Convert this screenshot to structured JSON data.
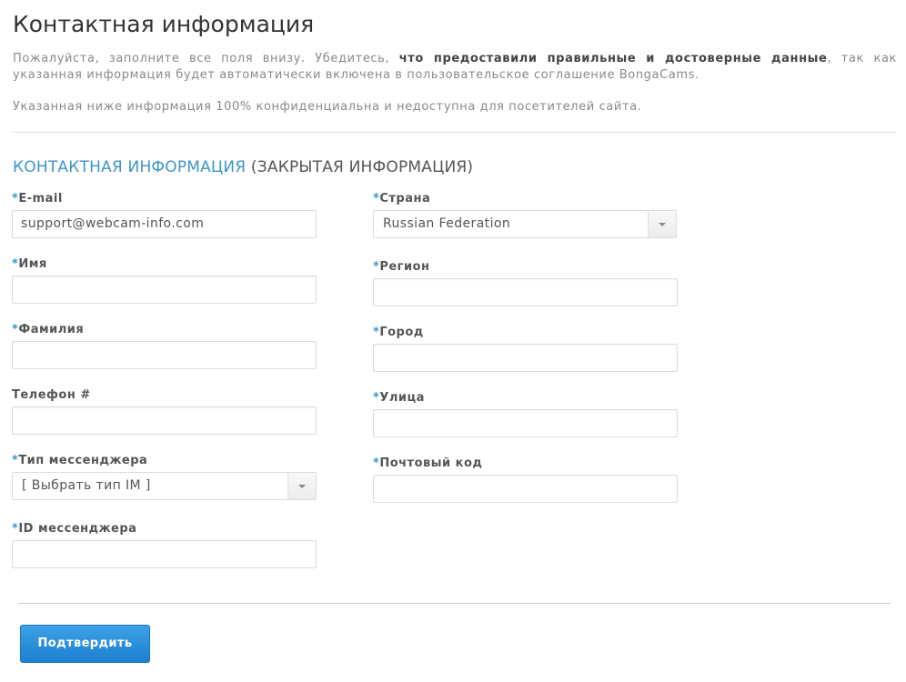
{
  "page": {
    "title": "Контактная информация",
    "intro_before": "Пожалуйста, заполните все поля внизу. Убедитесь, ",
    "intro_bold": "что предоставили правильные и достоверные данные",
    "intro_after": ", так как указанная информация будет автоматически включена в пользовательское соглашение BongaCams.",
    "note": "Указанная ниже информация 100% конфиденциальна и недоступна для посетителей сайта."
  },
  "section": {
    "title_blue": "КОНТАКТНАЯ ИНФОРМАЦИЯ",
    "title_grey": " (ЗАКРЫТАЯ ИНФОРМАЦИЯ)"
  },
  "required_marker": "*",
  "left_fields": {
    "email": {
      "label": "E-mail",
      "value": "support@webcam-info.com"
    },
    "first_name": {
      "label": "Имя",
      "value": ""
    },
    "last_name": {
      "label": "Фамилия",
      "value": ""
    },
    "phone": {
      "label": "Телефон #",
      "value": ""
    },
    "messenger_type": {
      "label": "Тип мессенджера",
      "value": "[ Выбрать тип IM ]"
    },
    "messenger_id": {
      "label": "ID мессенджера",
      "value": ""
    }
  },
  "right_fields": {
    "country": {
      "label": "Страна",
      "value": "Russian Federation"
    },
    "region": {
      "label": "Регион",
      "value": ""
    },
    "city": {
      "label": "Город",
      "value": ""
    },
    "street": {
      "label": "Улица",
      "value": ""
    },
    "postal_code": {
      "label": "Почтовый код",
      "value": ""
    }
  },
  "submit": {
    "label": "Подтвердить"
  },
  "colors": {
    "accent_blue": "#3d95c9",
    "button_blue": "#2a8ddb"
  }
}
